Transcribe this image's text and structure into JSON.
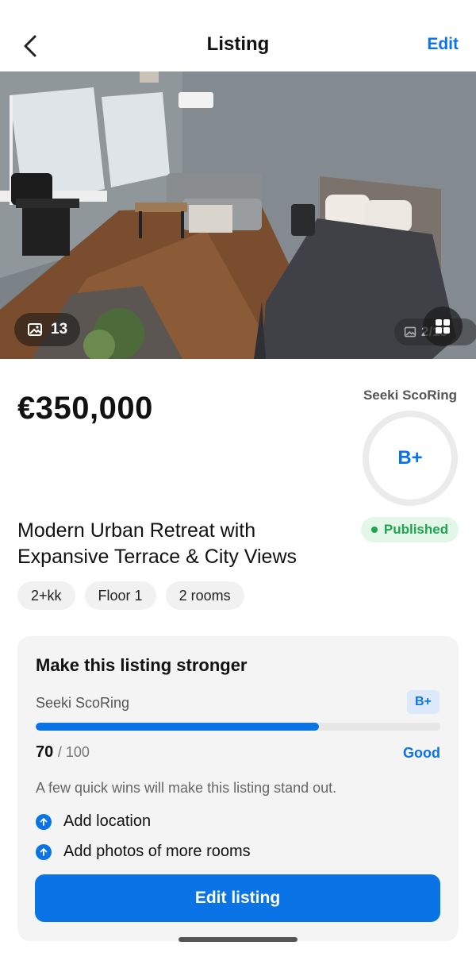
{
  "header": {
    "title": "Listing",
    "edit_label": "Edit",
    "back_icon": "chevron-left-icon"
  },
  "gallery": {
    "photo_count": "13",
    "current_index": "2/13",
    "photo_icon": "image-icon",
    "grid_icon": "grid-icon",
    "image_subject": "bedroom with bed, sofa and desk"
  },
  "price": "€350,000",
  "score": {
    "label": "Seeki ScoRing",
    "grade": "B+"
  },
  "status": {
    "label": "Published",
    "color": "#1fa450"
  },
  "listing": {
    "title": "Modern Urban Retreat with Expansive Terrace & City Views",
    "chips": [
      "2+kk",
      "Floor 1",
      "2 rooms"
    ]
  },
  "improve_card": {
    "title": "Make this listing stronger",
    "score_label": "Seeki ScoRing",
    "grade": "B+",
    "score_value": "70",
    "score_max": "/ 100",
    "progress_fraction": 0.7,
    "rating_word": "Good",
    "hint": "A few quick wins will make this listing stand out.",
    "todos": [
      "Add location",
      "Add photos of more rooms"
    ],
    "cta_label": "Edit listing"
  },
  "colors": {
    "accent": "#0a74e6",
    "published": "#1fa450",
    "card_bg": "#f4f4f5"
  }
}
